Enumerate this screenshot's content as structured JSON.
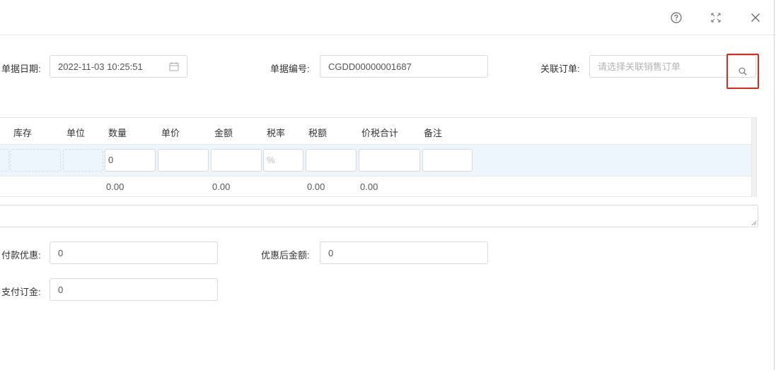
{
  "header": {
    "help_icon": "question-circle-icon",
    "fullscreen_icon": "expand-icon",
    "close_icon": "close-icon"
  },
  "form": {
    "doc_date_label": "单据日期:",
    "doc_date_value": "2022-11-03 10:25:51",
    "doc_no_label": "单据编号:",
    "doc_no_value": "CGDD00000001687",
    "related_order_label": "关联订单:",
    "related_order_placeholder": "请选择关联销售订单"
  },
  "table": {
    "columns": [
      "库存",
      "单位",
      "数量",
      "单价",
      "金额",
      "税率",
      "税额",
      "价税合计",
      "备注"
    ],
    "row": {
      "quantity": "0",
      "tax_rate_placeholder": "%"
    },
    "totals": {
      "quantity": "0.00",
      "amount": "0.00",
      "tax": "0.00",
      "total": "0.00"
    }
  },
  "payment": {
    "discount_label": "付款优惠:",
    "discount_value": "0",
    "after_discount_label": "优惠后金额:",
    "after_discount_value": "0",
    "deposit_label": "支付订金:",
    "deposit_value": "0"
  },
  "colors": {
    "highlight": "#e0281e",
    "row_bg": "#eef6fd",
    "border": "#d9d9d9"
  }
}
